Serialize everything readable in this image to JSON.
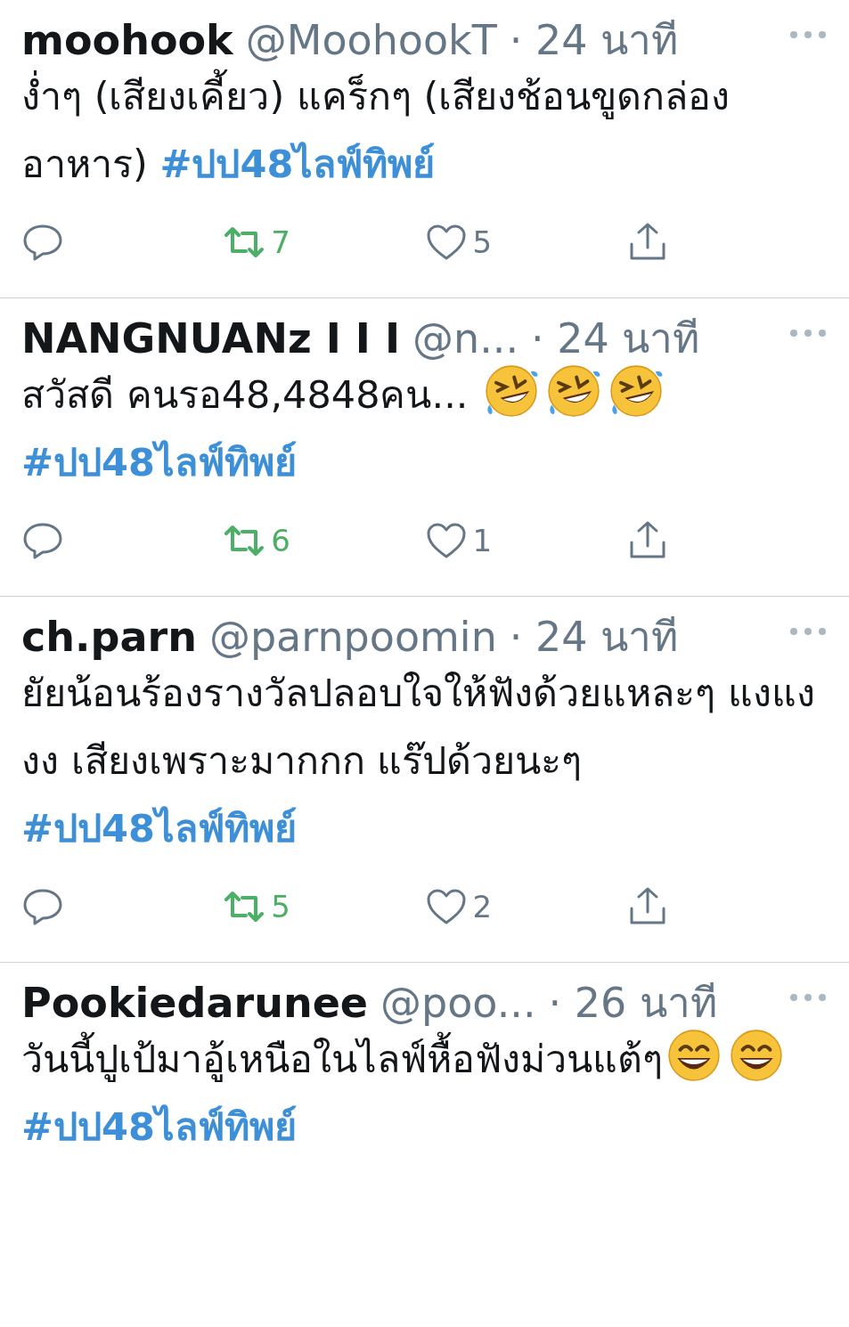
{
  "tweets": [
    {
      "name": "moohook",
      "handle": "@MoohookT",
      "time": "· 24 นาที",
      "body": [
        {
          "kind": "text",
          "text": "ง่ำๆ (เสียงเคี้ยว) แคร็กๆ (เสียงช้อนขูดกล่องอาหาร) "
        },
        {
          "kind": "hashtag",
          "text": "#ปป48ไลฟ์ทิพย์"
        }
      ],
      "actions": {
        "retweets": "7",
        "retweeted": true,
        "likes": "5",
        "liked": false
      }
    },
    {
      "name": "NANGNUANz I I I",
      "handle": "@n...",
      "time": "· 24 นาที",
      "body": [
        {
          "kind": "text",
          "text": "สวัสดี คนรอ48,4848คน... "
        },
        {
          "kind": "rofl_emoji"
        },
        {
          "kind": "rofl_emoji"
        },
        {
          "kind": "rofl_emoji"
        },
        {
          "kind": "break"
        },
        {
          "kind": "hashtag",
          "text": "#ปป48ไลฟ์ทิพย์"
        }
      ],
      "actions": {
        "retweets": "6",
        "retweeted": true,
        "likes": "1",
        "liked": false
      }
    },
    {
      "name": "ch.parn",
      "handle": "@parnpoomin",
      "time": "· 24 นาที",
      "body": [
        {
          "kind": "text",
          "text": "ยัยน้อนร้องรางวัลปลอบใจให้ฟังด้วยแหละๆ แงแงงง เสียงเพราะมากกก แร๊ปด้วยนะๆ"
        },
        {
          "kind": "break"
        },
        {
          "kind": "hashtag",
          "text": "#ปป48ไลฟ์ทิพย์"
        }
      ],
      "actions": {
        "retweets": "5",
        "retweeted": true,
        "likes": "2",
        "liked": false
      }
    },
    {
      "name": "Pookiedarunee",
      "handle": "@poo...",
      "time": "· 26 นาที",
      "body": [
        {
          "kind": "text",
          "text": "วันนี้ปูเป้มาอู้เหนือในไลฟ์หื้อฟังม่วนแต้ๆ"
        },
        {
          "kind": "grin_emoji"
        },
        {
          "kind": "grin_emoji"
        },
        {
          "kind": "hashtag",
          "text": "#ปป48ไลฟ์ทิพย์"
        }
      ]
    }
  ]
}
